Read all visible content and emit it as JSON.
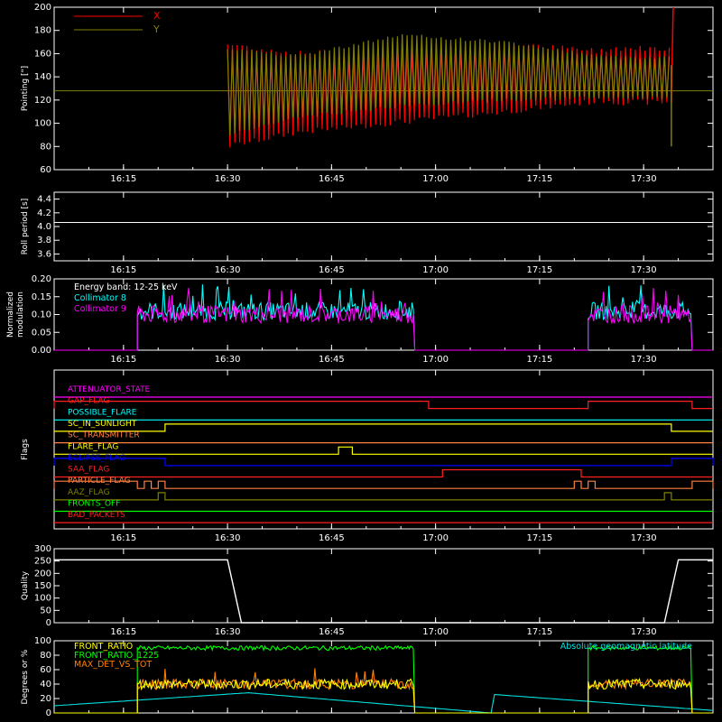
{
  "chart_data": [
    {
      "type": "line",
      "ylabel": "Pointing [\"]",
      "ylim": [
        60,
        200
      ],
      "yticks": [
        60,
        80,
        100,
        120,
        140,
        160,
        180,
        200
      ],
      "xticks": [
        "16:15",
        "16:30",
        "16:45",
        "17:00",
        "17:15",
        "17:30"
      ],
      "xlim_minutes": [
        "16:05",
        "17:40"
      ],
      "legend": "top-left",
      "series": [
        {
          "name": "X",
          "color": "#ff0000",
          "envelope_upper": [
            [
              16.3,
              168
            ],
            [
              16.4,
              160
            ],
            [
              16.7,
              168
            ],
            [
              16.85,
              162
            ],
            [
              17.0,
              165
            ],
            [
              17.2,
              165
            ],
            [
              17.34,
              165
            ]
          ],
          "envelope_lower": [
            [
              16.3,
              80
            ],
            [
              16.4,
              92
            ],
            [
              16.7,
              110
            ],
            [
              16.85,
              120
            ],
            [
              17.0,
              118
            ],
            [
              17.2,
              118
            ],
            [
              17.34,
              118
            ]
          ],
          "end_spike": 200
        },
        {
          "name": "Y",
          "color": "#808000",
          "envelope_upper": [
            [
              16.3,
              165
            ],
            [
              16.4,
              158
            ],
            [
              16.55,
              176
            ],
            [
              16.7,
              170
            ],
            [
              16.85,
              157
            ],
            [
              17.34,
              157
            ]
          ],
          "envelope_lower": [
            [
              16.3,
              90
            ],
            [
              16.4,
              105
            ],
            [
              16.55,
              115
            ],
            [
              16.7,
              120
            ],
            [
              16.85,
              122
            ],
            [
              17.34,
              122
            ]
          ],
          "baseline": 128
        }
      ]
    },
    {
      "type": "line",
      "ylabel": "Roll period [s]",
      "ylim": [
        3.5,
        4.5
      ],
      "yticks": [
        "3.6",
        "3.8",
        "4.0",
        "4.2",
        "4.4"
      ],
      "xticks": [
        "16:15",
        "16:30",
        "16:45",
        "17:00",
        "17:15",
        "17:30"
      ],
      "series": [
        {
          "color": "#ffffff",
          "values": [
            4.06
          ]
        }
      ]
    },
    {
      "type": "line",
      "ylabel": "Normalized modulation",
      "ylim": [
        0,
        0.2
      ],
      "yticks": [
        "0.00",
        "0.05",
        "0.10",
        "0.15",
        "0.20"
      ],
      "xticks": [
        "16:15",
        "16:30",
        "16:45",
        "17:00",
        "17:15",
        "17:30"
      ],
      "legend_title": "Energy band: 12-25 keV",
      "series": [
        {
          "name": "Collimator 8",
          "color": "#00ffff",
          "typical": 0.11,
          "active": [
            [
              "16:17",
              "16:57"
            ],
            [
              "17:22",
              "17:37"
            ]
          ]
        },
        {
          "name": "Collimator 9",
          "color": "#ff00ff",
          "typical": 0.1,
          "active": [
            [
              "16:17",
              "16:57"
            ],
            [
              "17:22",
              "17:37"
            ]
          ]
        }
      ]
    },
    {
      "type": "line",
      "ylabel": "Flags",
      "xticks": [
        "16:15",
        "16:30",
        "16:45",
        "17:00",
        "17:15",
        "17:30"
      ],
      "series": [
        {
          "name": "ATTENUATOR_STATE",
          "color": "#ff00ff",
          "high": []
        },
        {
          "name": "GAP_FLAG",
          "color": "#ff2020",
          "high": [
            [
              "16:05",
              "16:59"
            ],
            [
              "17:22",
              "17:37"
            ]
          ]
        },
        {
          "name": "POSSIBLE_FLARE",
          "color": "#00ffff",
          "high": []
        },
        {
          "name": "SC_IN_SUNLIGHT",
          "color": "#ffff00",
          "high": [
            [
              "16:21",
              "17:34"
            ]
          ]
        },
        {
          "name": "SC_TRANSMITTER",
          "color": "#ff8040",
          "high": []
        },
        {
          "name": "FLARE_FLAG",
          "color": "#ffff00",
          "high": [
            [
              "16:46",
              "16:48"
            ]
          ]
        },
        {
          "name": "ECLIPSE_FLAG",
          "color": "#0000ff",
          "high": [
            [
              "16:05",
              "16:21"
            ],
            [
              "17:34",
              "17:40"
            ]
          ]
        },
        {
          "name": "SAA_FLAG",
          "color": "#ff2020",
          "high": [
            [
              "17:01",
              "17:21"
            ]
          ]
        },
        {
          "name": "PARTICLE_FLAG",
          "color": "#ff8040",
          "high": [
            [
              "16:05",
              "16:17"
            ],
            [
              "16:18",
              "16:19"
            ],
            [
              "16:20",
              "16:21"
            ],
            [
              "17:20",
              "17:21"
            ],
            [
              "17:22",
              "17:23"
            ],
            [
              "17:37",
              "17:40"
            ]
          ]
        },
        {
          "name": "AAZ_FLAG",
          "color": "#808000",
          "high": [
            [
              "16:20",
              "16:21"
            ],
            [
              "17:33",
              "17:34"
            ]
          ]
        },
        {
          "name": "FRONTS_OFF",
          "color": "#00ff00",
          "high": []
        },
        {
          "name": "BAD_PACKETS",
          "color": "#ff2020",
          "high": []
        }
      ]
    },
    {
      "type": "line",
      "ylabel": "Quality",
      "ylim": [
        0,
        300
      ],
      "yticks": [
        0,
        50,
        100,
        150,
        200,
        250,
        300
      ],
      "xticks": [
        "16:15",
        "16:30",
        "16:45",
        "17:00",
        "17:15",
        "17:30"
      ],
      "series": [
        {
          "color": "#ffffff",
          "values": [
            [
              16.05,
              255
            ],
            [
              16.3,
              255
            ],
            [
              16.32,
              0
            ],
            [
              17.33,
              0
            ],
            [
              17.35,
              255
            ],
            [
              17.4,
              255
            ]
          ]
        }
      ]
    },
    {
      "type": "line",
      "ylabel": "Degrees or %",
      "ylim": [
        0,
        100
      ],
      "yticks": [
        0,
        20,
        40,
        60,
        80,
        100
      ],
      "xticks": [
        "16:15",
        "16:30",
        "16:45",
        "17:00",
        "17:15",
        "17:30"
      ],
      "series": [
        {
          "name": "FRONT_RATIO",
          "color": "#ffff00",
          "typical": 40,
          "active": [
            [
              "16:17",
              "16:57"
            ],
            [
              "17:22",
              "17:37"
            ]
          ]
        },
        {
          "name": "FRONT_RATIO_1225",
          "color": "#00ff00",
          "typical": 90,
          "active": [
            [
              "16:17",
              "16:57"
            ],
            [
              "17:22",
              "17:37"
            ]
          ]
        },
        {
          "name": "MAX_DET_VS_TOT",
          "color": "#ff8000",
          "typical": 40,
          "active": [
            [
              "16:17",
              "16:57"
            ],
            [
              "17:22",
              "17:37"
            ]
          ]
        },
        {
          "name": "Absolute geomagnetic latitude",
          "color": "#00e0e0",
          "values": [
            [
              16.05,
              10
            ],
            [
              16.33,
              28
            ],
            [
              16.68,
              0
            ],
            [
              17.05,
              28
            ],
            [
              17.45,
              0
            ],
            [
              17.7,
              28
            ]
          ]
        }
      ]
    }
  ]
}
